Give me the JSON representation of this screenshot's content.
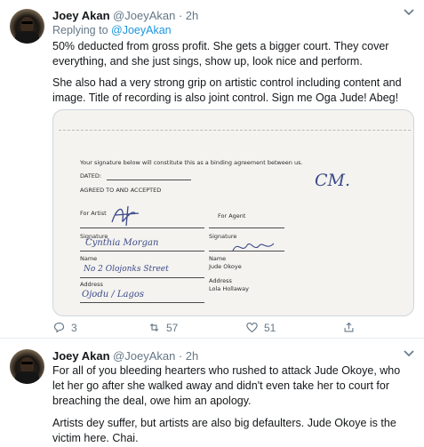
{
  "tweet1": {
    "name": "Joey Akan",
    "handle": "@JoeyAkan",
    "time": "· 2h",
    "replying_prefix": "Replying to ",
    "replying_to": "@JoeyAkan",
    "paragraph1": "50% deducted from gross profit. She gets a bigger court. They cover everything, and she just sings, show up, look nice and perform.",
    "paragraph2": "She also had a very strong grip on artistic control including content and image. Title of recording is also joint control. Sign me Oga Jude! Abeg!",
    "document": {
      "intro": "Your signature below will constitute this as a binding agreement between us.",
      "dated": "DATED:",
      "agreed": "AGREED TO AND ACCEPTED",
      "for_artist": "For Artist",
      "for_agent": "For Agent",
      "signature": "Signature",
      "signature2": "Signature",
      "name_label": "Name",
      "name_label2": "Name",
      "agent_name": "Jude Okoye",
      "address_label": "Address",
      "address_label2": "Address",
      "agent_address": "Lola Hollaway",
      "hand_initials": "CM.",
      "hand_artist_name": "Cynthia Morgan",
      "hand_address1": "No 2 Olojonks Street",
      "hand_address2": "Ojodu / Lagos"
    },
    "actions": {
      "replies": "3",
      "retweets": "57",
      "likes": "51"
    }
  },
  "tweet2": {
    "name": "Joey Akan",
    "handle": "@JoeyAkan",
    "time": "· 2h",
    "paragraph1": "For all of you bleeding hearters who rushed to attack Jude Okoye, who let her go after she walked away and didn't even take her to court for breaching the deal, owe him an apology.",
    "paragraph2": "Artists dey suffer, but artists are also big defaulters. Jude Okoye is the victim here. Chai."
  }
}
